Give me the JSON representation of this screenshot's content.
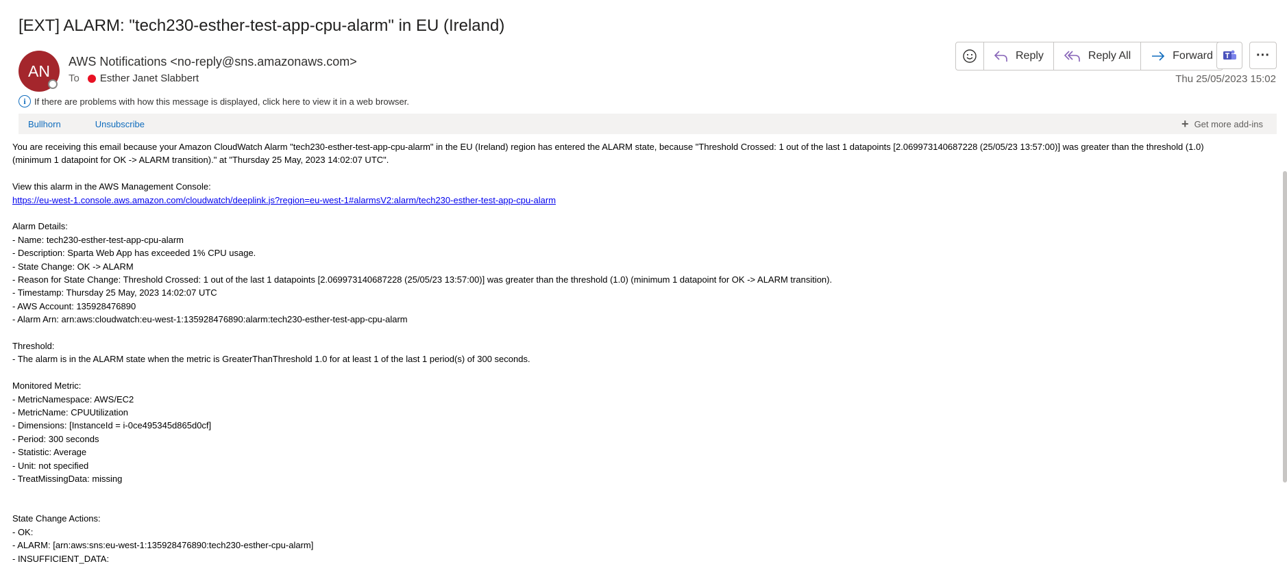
{
  "email": {
    "subject": "[EXT] ALARM: \"tech230-esther-test-app-cpu-alarm\" in EU (Ireland)",
    "avatar_initials": "AN",
    "sender": "AWS Notifications <no-reply@sns.amazonaws.com>",
    "to_label": "To",
    "recipient": "Esther Janet Slabbert",
    "info_text": "If there are problems with how this message is displayed, click here to view it in a web browser.",
    "date": "Thu 25/05/2023 15:02"
  },
  "toolbar": {
    "emoji_icon": "emoji-icon",
    "reply_label": "Reply",
    "reply_all_label": "Reply All",
    "forward_label": "Forward",
    "teams_icon": "teams-icon",
    "more_icon": "more-icon",
    "more_glyph": "···"
  },
  "addins": {
    "items": [
      "Bullhorn",
      "Unsubscribe"
    ],
    "get_more_label": "Get more add-ins"
  },
  "body": {
    "intro_line1": "You are receiving this email because your Amazon CloudWatch Alarm \"tech230-esther-test-app-cpu-alarm\" in the EU (Ireland) region has entered the ALARM state, because \"Threshold Crossed: 1 out of the last 1 datapoints [2.069973140687228 (25/05/23 13:57:00)] was greater than the threshold (1.0)",
    "intro_line2": "(minimum 1 datapoint for OK -> ALARM transition).\" at \"Thursday 25 May, 2023 14:02:07 UTC\".",
    "console_label": "View this alarm in the AWS Management Console:",
    "console_link": "https://eu-west-1.console.aws.amazon.com/cloudwatch/deeplink.js?region=eu-west-1#alarmsV2:alarm/tech230-esther-test-app-cpu-alarm",
    "details_heading": "Alarm Details:",
    "details": [
      "- Name: tech230-esther-test-app-cpu-alarm",
      "- Description: Sparta Web App has exceeded 1% CPU usage.",
      "- State Change: OK -> ALARM",
      "- Reason for State Change: Threshold Crossed: 1 out of the last 1 datapoints [2.069973140687228 (25/05/23 13:57:00)] was greater than the threshold (1.0) (minimum 1 datapoint for OK -> ALARM transition).",
      "- Timestamp: Thursday 25 May, 2023 14:02:07 UTC",
      "- AWS Account: 135928476890",
      "- Alarm Arn: arn:aws:cloudwatch:eu-west-1:135928476890:alarm:tech230-esther-test-app-cpu-alarm"
    ],
    "threshold_heading": "Threshold:",
    "threshold_line": "- The alarm is in the ALARM state when the metric is GreaterThanThreshold 1.0 for at least 1 of the last 1 period(s) of 300 seconds.",
    "metric_heading": "Monitored Metric:",
    "metric": [
      "- MetricNamespace: AWS/EC2",
      "- MetricName: CPUUtilization",
      "- Dimensions: [InstanceId = i-0ce495345d865d0cf]",
      "- Period: 300 seconds",
      "- Statistic: Average",
      "- Unit: not specified",
      "- TreatMissingData: missing"
    ],
    "actions_heading": "State Change Actions:",
    "actions": [
      "- OK:",
      "- ALARM: [arn:aws:sns:eu-west-1:135928476890:tech230-esther-cpu-alarm]",
      "- INSUFFICIENT_DATA:"
    ]
  }
}
